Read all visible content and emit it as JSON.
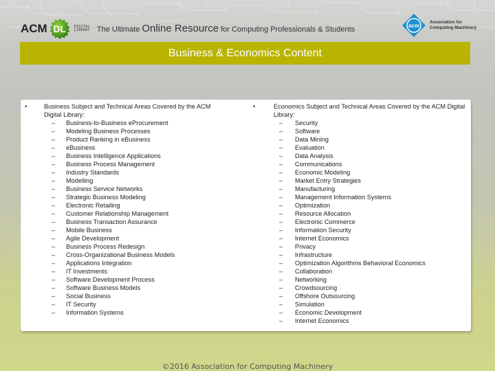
{
  "header": {
    "acm_label": "ACM",
    "dl_label": "DL",
    "digital_library_line1": "DIGITAL",
    "digital_library_line2": "LIBRARY",
    "tagline_part1": "The Ultimate ",
    "tagline_part2": "Online Resource",
    "tagline_part3": " for Computing Professionals & Students",
    "assoc_logo_label": "acm",
    "assoc_line1": "Association for",
    "assoc_line2": "Computing Machinery",
    "colors": {
      "dl_green": "#4a9a1a",
      "acm_blue": "#1e8fd0"
    }
  },
  "title_bar": {
    "title": "Business & Economics Content",
    "color": "#b8b400"
  },
  "business": {
    "bullet": "•",
    "heading": "Business Subject and Technical Areas Covered by the ACM Digital Library:",
    "items": [
      "Business-to-Business eProcurement",
      "Modeling Business Processes",
      "Product Ranking in eBusiness",
      "eBusiness",
      "Business Intelligence Applications",
      "Business Process Management",
      "Industry Standards",
      "Modelling",
      "Business Service Networks",
      "Strategic Business Modeling",
      "Electronic Retailing",
      "Customer Relationship Management",
      "Business Transaction Assurance",
      "Mobile Business",
      "Agile Development",
      "Business Process Redesign",
      "Cross-Organizational Business Models",
      "Applications Integration",
      "IT Investments",
      "Software Development Process",
      "Software Business Models",
      "Social Business",
      "IT Security",
      "Information Systems"
    ]
  },
  "economics": {
    "bullet": "•",
    "heading": "Economics Subject and Technical Areas Covered by the ACM Digital Library:",
    "items": [
      "Security",
      "Software",
      "Data Mining",
      "Evaluation",
      "Data Analysis",
      "Communications",
      "Economic Modeling",
      "Market Entry Strategies",
      "Manufacturing",
      "Management Information Systems",
      "Optimization",
      "Resource Allocation",
      "Electronic Commerce",
      "Information Security",
      "Internet Economics",
      "Privacy",
      "Infrastructure",
      "Optimization Algorithms Behavioral Economics",
      "Collaboration",
      "Networking",
      "Crowdsourcing",
      "Offshore Outsourcing",
      "Simulation",
      "Economic Development",
      "Internet Economics"
    ]
  },
  "dash": "–",
  "footer": {
    "copyright": "©2016 Association for Computing Machinery"
  }
}
